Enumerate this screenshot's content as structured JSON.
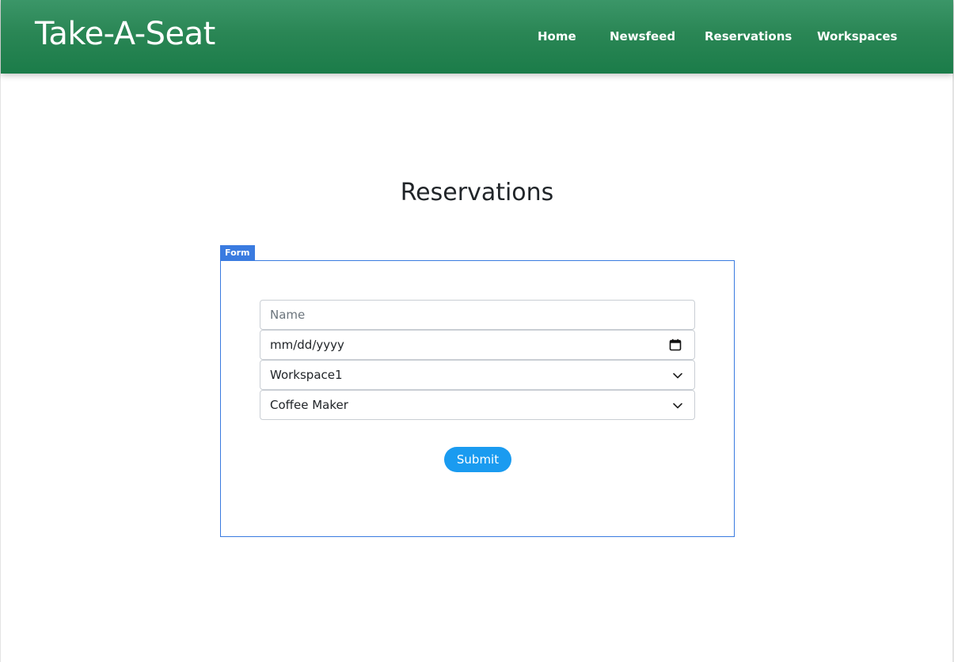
{
  "navbar": {
    "brand": "Take-A-Seat",
    "links": [
      {
        "label": "Home"
      },
      {
        "label": "Newsfeed"
      },
      {
        "label": "Reservations"
      },
      {
        "label": "Workspaces"
      }
    ]
  },
  "main": {
    "title": "Reservations",
    "form": {
      "tag": "Form",
      "name": {
        "placeholder": "Name",
        "value": ""
      },
      "date": {
        "placeholder": "mm/dd/yyyy",
        "icon": "calendar-icon"
      },
      "workspace": {
        "selected": "Workspace1",
        "icon": "chevron-down-icon"
      },
      "amenity": {
        "selected": "Coffee Maker",
        "icon": "chevron-down-icon"
      },
      "submit_label": "Submit"
    }
  },
  "colors": {
    "navbar_green": "#2a8655",
    "form_border": "#3a7be0",
    "submit_blue": "#1a9bf0"
  }
}
